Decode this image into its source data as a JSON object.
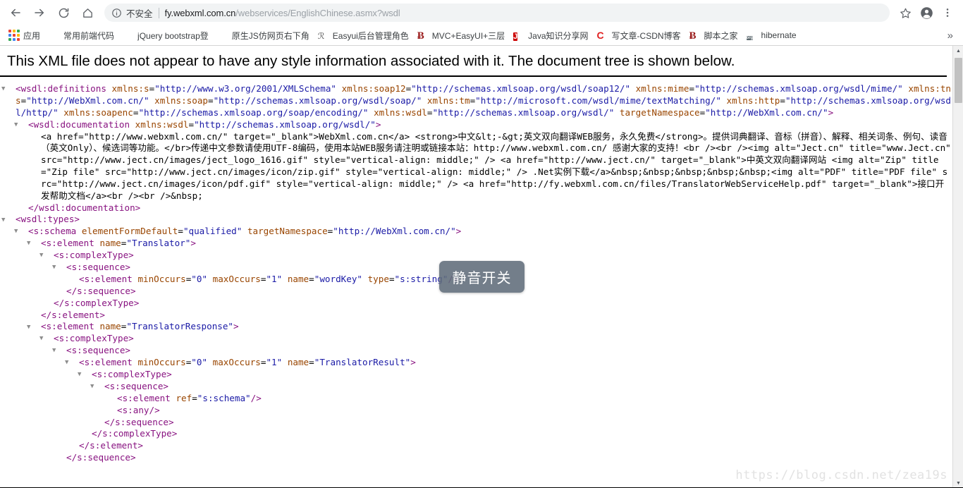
{
  "browser": {
    "nav": {
      "back": "back-arrow",
      "forward": "forward-arrow",
      "reload": "reload",
      "home": "home"
    },
    "omnibox": {
      "info_icon": "info-circle-icon",
      "security_label": "不安全",
      "url_host": "fy.webxml.com.cn",
      "url_path": "/webservices/EnglishChinese.asmx?wsdl",
      "url_full": "fy.webxml.com.cn/webservices/EnglishChinese.asmx?wsdl"
    },
    "actions": {
      "bookmark_star": "star-icon",
      "profile": "account-avatar-icon",
      "menu": "three-dot-menu-icon"
    },
    "bookmarks": [
      {
        "label": "应用",
        "icon": "apps-grid-icon"
      },
      {
        "label": "常用前端代码",
        "icon": "red-circle-icon"
      },
      {
        "label": "jQuery bootstrap登",
        "icon": "red-circle-icon"
      },
      {
        "label": "原生JS仿网页右下角",
        "icon": "red-circle-icon"
      },
      {
        "label": "Easyui后台管理角色",
        "icon": "script-icon"
      },
      {
        "label": "MVC+EasyUI+三层",
        "icon": "b-letter-icon"
      },
      {
        "label": "Java知识分享网",
        "icon": "j-letter-icon"
      },
      {
        "label": "写文章-CSDN博客",
        "icon": "c-letter-icon"
      },
      {
        "label": "脚本之家",
        "icon": "b-letter-icon"
      },
      {
        "label": "hibernate",
        "icon": "hibernate-icon"
      }
    ],
    "bookmarks_overflow": "»"
  },
  "page": {
    "notice": "This XML file does not appear to have any style information associated with it. The document tree is shown below.",
    "watermark": "https://blog.csdn.net/zea19s",
    "tooltip": "静音开关",
    "scrollbar": {
      "up_arrow": "▲",
      "down_arrow": "▼"
    }
  },
  "xml": {
    "lines": [
      {
        "indent": 0,
        "triangle": "▼",
        "parts": [
          {
            "t": "punc",
            "s": "<"
          },
          {
            "t": "tag",
            "s": "wsdl:definitions"
          },
          {
            "t": "txt",
            "s": " "
          },
          {
            "t": "attr",
            "s": "xmlns:s"
          },
          {
            "t": "txt",
            "s": "="
          },
          {
            "t": "val",
            "s": "\"http://www.w3.org/2001/XMLSchema\""
          },
          {
            "t": "txt",
            "s": " "
          },
          {
            "t": "attr",
            "s": "xmlns:soap12"
          },
          {
            "t": "txt",
            "s": "="
          },
          {
            "t": "val",
            "s": "\"http://schemas.xmlsoap.org/wsdl/soap12/\""
          },
          {
            "t": "txt",
            "s": " "
          },
          {
            "t": "attr",
            "s": "xmlns:mime"
          },
          {
            "t": "txt",
            "s": "="
          },
          {
            "t": "val",
            "s": "\"http://schemas.xmlsoap.org/wsdl/mime/\""
          },
          {
            "t": "txt",
            "s": " "
          },
          {
            "t": "attr",
            "s": "xmlns:tns"
          },
          {
            "t": "txt",
            "s": "="
          },
          {
            "t": "val",
            "s": "\"http://WebXml.com.cn/\""
          },
          {
            "t": "txt",
            "s": " "
          },
          {
            "t": "attr",
            "s": "xmlns:soap"
          },
          {
            "t": "txt",
            "s": "="
          },
          {
            "t": "val",
            "s": "\"http://schemas.xmlsoap.org/wsdl/soap/\""
          },
          {
            "t": "txt",
            "s": " "
          },
          {
            "t": "attr",
            "s": "xmlns:tm"
          },
          {
            "t": "txt",
            "s": "="
          },
          {
            "t": "val",
            "s": "\"http://microsoft.com/wsdl/mime/textMatching/\""
          },
          {
            "t": "txt",
            "s": " "
          },
          {
            "t": "attr",
            "s": "xmlns:http"
          },
          {
            "t": "txt",
            "s": "="
          },
          {
            "t": "val",
            "s": "\"http://schemas.xmlsoap.org/wsdl/http/\""
          },
          {
            "t": "txt",
            "s": " "
          },
          {
            "t": "attr",
            "s": "xmlns:soapenc"
          },
          {
            "t": "txt",
            "s": "="
          },
          {
            "t": "val",
            "s": "\"http://schemas.xmlsoap.org/soap/encoding/\""
          },
          {
            "t": "txt",
            "s": " "
          },
          {
            "t": "attr",
            "s": "xmlns:wsdl"
          },
          {
            "t": "txt",
            "s": "="
          },
          {
            "t": "val",
            "s": "\"http://schemas.xmlsoap.org/wsdl/\""
          },
          {
            "t": "txt",
            "s": " "
          },
          {
            "t": "attr",
            "s": "targetNamespace"
          },
          {
            "t": "txt",
            "s": "="
          },
          {
            "t": "val",
            "s": "\"http://WebXml.com.cn/\""
          },
          {
            "t": "punc",
            "s": ">"
          }
        ]
      },
      {
        "indent": 1,
        "triangle": "▼",
        "parts": [
          {
            "t": "punc",
            "s": "<"
          },
          {
            "t": "tag",
            "s": "wsdl:documentation"
          },
          {
            "t": "txt",
            "s": " "
          },
          {
            "t": "attr",
            "s": "xmlns:wsdl"
          },
          {
            "t": "txt",
            "s": "="
          },
          {
            "t": "val",
            "s": "\"http://schemas.xmlsoap.org/wsdl/\""
          },
          {
            "t": "punc",
            "s": ">"
          }
        ]
      },
      {
        "indent": 2,
        "triangle": "",
        "parts": [
          {
            "t": "txt",
            "s": "<a href=\"http://www.webxml.com.cn/\" target=\"_blank\">WebXml.com.cn</a> <strong>中文&lt;-&gt;英文双向翻译WEB服务，永久免费</strong>。提供词典翻译、音标（拼音）、解释、相关词条、例句、读音（英文Only）、候选词等功能。</br>传递中文参数请使用UTF-8编码，使用本站WEB服务请注明或链接本站：http://www.webxml.com.cn/ 感谢大家的支持！<br /><br /><img alt=\"Ject.cn\" title=\"www.Ject.cn\" src=\"http://www.ject.cn/images/ject_logo_1616.gif\" style=\"vertical-align: middle;\" /> <a href=\"http://www.ject.cn/\" target=\"_blank\">中英文双向翻译网站 <img alt=\"Zip\" title=\"Zip file\" src=\"http://www.ject.cn/images/icon/zip.gif\" style=\"vertical-align: middle;\" /> .Net实例下载</a>&nbsp;&nbsp;&nbsp;&nbsp;&nbsp;<img alt=\"PDF\" title=\"PDF file\" src=\"http://www.ject.cn/images/icon/pdf.gif\" style=\"vertical-align: middle;\" /> <a href=\"http://fy.webxml.com.cn/files/TranslatorWebServiceHelp.pdf\" target=\"_blank\">接口开发帮助文档</a><br /><br />&nbsp;"
          }
        ]
      },
      {
        "indent": 1,
        "triangle": "",
        "parts": [
          {
            "t": "punc",
            "s": "</"
          },
          {
            "t": "tag",
            "s": "wsdl:documentation"
          },
          {
            "t": "punc",
            "s": ">"
          }
        ]
      },
      {
        "indent": 0,
        "triangle": "▼",
        "parts": [
          {
            "t": "punc",
            "s": "<"
          },
          {
            "t": "tag",
            "s": "wsdl:types"
          },
          {
            "t": "punc",
            "s": ">"
          }
        ]
      },
      {
        "indent": 1,
        "triangle": "▼",
        "parts": [
          {
            "t": "punc",
            "s": "<"
          },
          {
            "t": "tag",
            "s": "s:schema"
          },
          {
            "t": "txt",
            "s": " "
          },
          {
            "t": "attr",
            "s": "elementFormDefault"
          },
          {
            "t": "txt",
            "s": "="
          },
          {
            "t": "val",
            "s": "\"qualified\""
          },
          {
            "t": "txt",
            "s": " "
          },
          {
            "t": "attr",
            "s": "targetNamespace"
          },
          {
            "t": "txt",
            "s": "="
          },
          {
            "t": "val",
            "s": "\"http://WebXml.com.cn/\""
          },
          {
            "t": "punc",
            "s": ">"
          }
        ]
      },
      {
        "indent": 2,
        "triangle": "▼",
        "parts": [
          {
            "t": "punc",
            "s": "<"
          },
          {
            "t": "tag",
            "s": "s:element"
          },
          {
            "t": "txt",
            "s": " "
          },
          {
            "t": "attr",
            "s": "name"
          },
          {
            "t": "txt",
            "s": "="
          },
          {
            "t": "val",
            "s": "\"Translator\""
          },
          {
            "t": "punc",
            "s": ">"
          }
        ]
      },
      {
        "indent": 3,
        "triangle": "▼",
        "parts": [
          {
            "t": "punc",
            "s": "<"
          },
          {
            "t": "tag",
            "s": "s:complexType"
          },
          {
            "t": "punc",
            "s": ">"
          }
        ]
      },
      {
        "indent": 4,
        "triangle": "▼",
        "parts": [
          {
            "t": "punc",
            "s": "<"
          },
          {
            "t": "tag",
            "s": "s:sequence"
          },
          {
            "t": "punc",
            "s": ">"
          }
        ]
      },
      {
        "indent": 5,
        "triangle": "",
        "parts": [
          {
            "t": "punc",
            "s": "<"
          },
          {
            "t": "tag",
            "s": "s:element"
          },
          {
            "t": "txt",
            "s": " "
          },
          {
            "t": "attr",
            "s": "minOccurs"
          },
          {
            "t": "txt",
            "s": "="
          },
          {
            "t": "val",
            "s": "\"0\""
          },
          {
            "t": "txt",
            "s": " "
          },
          {
            "t": "attr",
            "s": "maxOccurs"
          },
          {
            "t": "txt",
            "s": "="
          },
          {
            "t": "val",
            "s": "\"1\""
          },
          {
            "t": "txt",
            "s": " "
          },
          {
            "t": "attr",
            "s": "name"
          },
          {
            "t": "txt",
            "s": "="
          },
          {
            "t": "val",
            "s": "\"wordKey\""
          },
          {
            "t": "txt",
            "s": " "
          },
          {
            "t": "attr",
            "s": "type"
          },
          {
            "t": "txt",
            "s": "="
          },
          {
            "t": "val",
            "s": "\"s:string\""
          },
          {
            "t": "punc",
            "s": "/>"
          }
        ]
      },
      {
        "indent": 4,
        "triangle": "",
        "parts": [
          {
            "t": "punc",
            "s": "</"
          },
          {
            "t": "tag",
            "s": "s:sequence"
          },
          {
            "t": "punc",
            "s": ">"
          }
        ]
      },
      {
        "indent": 3,
        "triangle": "",
        "parts": [
          {
            "t": "punc",
            "s": "</"
          },
          {
            "t": "tag",
            "s": "s:complexType"
          },
          {
            "t": "punc",
            "s": ">"
          }
        ]
      },
      {
        "indent": 2,
        "triangle": "",
        "parts": [
          {
            "t": "punc",
            "s": "</"
          },
          {
            "t": "tag",
            "s": "s:element"
          },
          {
            "t": "punc",
            "s": ">"
          }
        ]
      },
      {
        "indent": 2,
        "triangle": "▼",
        "parts": [
          {
            "t": "punc",
            "s": "<"
          },
          {
            "t": "tag",
            "s": "s:element"
          },
          {
            "t": "txt",
            "s": " "
          },
          {
            "t": "attr",
            "s": "name"
          },
          {
            "t": "txt",
            "s": "="
          },
          {
            "t": "val",
            "s": "\"TranslatorResponse\""
          },
          {
            "t": "punc",
            "s": ">"
          }
        ]
      },
      {
        "indent": 3,
        "triangle": "▼",
        "parts": [
          {
            "t": "punc",
            "s": "<"
          },
          {
            "t": "tag",
            "s": "s:complexType"
          },
          {
            "t": "punc",
            "s": ">"
          }
        ]
      },
      {
        "indent": 4,
        "triangle": "▼",
        "parts": [
          {
            "t": "punc",
            "s": "<"
          },
          {
            "t": "tag",
            "s": "s:sequence"
          },
          {
            "t": "punc",
            "s": ">"
          }
        ]
      },
      {
        "indent": 5,
        "triangle": "▼",
        "parts": [
          {
            "t": "punc",
            "s": "<"
          },
          {
            "t": "tag",
            "s": "s:element"
          },
          {
            "t": "txt",
            "s": " "
          },
          {
            "t": "attr",
            "s": "minOccurs"
          },
          {
            "t": "txt",
            "s": "="
          },
          {
            "t": "val",
            "s": "\"0\""
          },
          {
            "t": "txt",
            "s": " "
          },
          {
            "t": "attr",
            "s": "maxOccurs"
          },
          {
            "t": "txt",
            "s": "="
          },
          {
            "t": "val",
            "s": "\"1\""
          },
          {
            "t": "txt",
            "s": " "
          },
          {
            "t": "attr",
            "s": "name"
          },
          {
            "t": "txt",
            "s": "="
          },
          {
            "t": "val",
            "s": "\"TranslatorResult\""
          },
          {
            "t": "punc",
            "s": ">"
          }
        ]
      },
      {
        "indent": 6,
        "triangle": "▼",
        "parts": [
          {
            "t": "punc",
            "s": "<"
          },
          {
            "t": "tag",
            "s": "s:complexType"
          },
          {
            "t": "punc",
            "s": ">"
          }
        ]
      },
      {
        "indent": 7,
        "triangle": "▼",
        "parts": [
          {
            "t": "punc",
            "s": "<"
          },
          {
            "t": "tag",
            "s": "s:sequence"
          },
          {
            "t": "punc",
            "s": ">"
          }
        ]
      },
      {
        "indent": 8,
        "triangle": "",
        "parts": [
          {
            "t": "punc",
            "s": "<"
          },
          {
            "t": "tag",
            "s": "s:element"
          },
          {
            "t": "txt",
            "s": " "
          },
          {
            "t": "attr",
            "s": "ref"
          },
          {
            "t": "txt",
            "s": "="
          },
          {
            "t": "val",
            "s": "\"s:schema\""
          },
          {
            "t": "punc",
            "s": "/>"
          }
        ]
      },
      {
        "indent": 8,
        "triangle": "",
        "parts": [
          {
            "t": "punc",
            "s": "<"
          },
          {
            "t": "tag",
            "s": "s:any"
          },
          {
            "t": "punc",
            "s": "/>"
          }
        ]
      },
      {
        "indent": 7,
        "triangle": "",
        "parts": [
          {
            "t": "punc",
            "s": "</"
          },
          {
            "t": "tag",
            "s": "s:sequence"
          },
          {
            "t": "punc",
            "s": ">"
          }
        ]
      },
      {
        "indent": 6,
        "triangle": "",
        "parts": [
          {
            "t": "punc",
            "s": "</"
          },
          {
            "t": "tag",
            "s": "s:complexType"
          },
          {
            "t": "punc",
            "s": ">"
          }
        ]
      },
      {
        "indent": 5,
        "triangle": "",
        "parts": [
          {
            "t": "punc",
            "s": "</"
          },
          {
            "t": "tag",
            "s": "s:element"
          },
          {
            "t": "punc",
            "s": ">"
          }
        ]
      },
      {
        "indent": 4,
        "triangle": "",
        "parts": [
          {
            "t": "punc",
            "s": "</"
          },
          {
            "t": "tag",
            "s": "s:sequence"
          },
          {
            "t": "punc",
            "s": ">"
          }
        ]
      }
    ]
  },
  "eq_widget": {
    "name": "audio-level-meter",
    "bars": [
      "#6d7585",
      "#6d7585",
      "#6d7585",
      "#6d7585",
      "#6d7585",
      "#d6c83a",
      "#d6c83a",
      "#d6c83a",
      "#d6c83a",
      "#5ec98f",
      "#5ec98f",
      "#5ec98f",
      "#5ec98f",
      "#5ec98f"
    ]
  },
  "colors": {
    "tag": "#881280",
    "attribute": "#994500",
    "value": "#1a1aa6",
    "text": "#000000",
    "tooltip_bg": "#606c7a",
    "scroll_thumb": "#c1c1c1",
    "watermark": "#e2e2e2"
  }
}
